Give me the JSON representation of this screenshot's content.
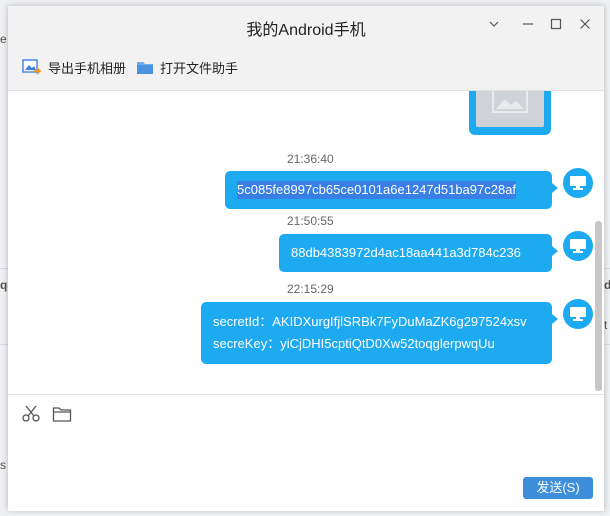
{
  "window": {
    "title": "我的Android手机"
  },
  "toolbar": {
    "export_album": "导出手机相册",
    "open_file_helper": "打开文件助手"
  },
  "messages": [
    {
      "time": "21:36:40",
      "lines": [
        "5c085fe8997cb65ce0101a6e1247d51ba97c28af"
      ]
    },
    {
      "time": "21:50:55",
      "lines": [
        "88db4383972d4ac18aa441a3d784c236"
      ]
    },
    {
      "time": "22:15:29",
      "lines": [
        "secretId：AKIDXurgIfjlSRBk7FyDuMaZK6g297524xsv",
        "secreKey：yiCjDHI5cptiQtD0Xw52toqglerpwqUu"
      ]
    }
  ],
  "input": {
    "send_label": "发送(S)"
  },
  "colors": {
    "bubble": "#1eaaf1",
    "send_button": "#3d8fdc",
    "selection": "#3a7fe6"
  },
  "icons": [
    "image-export-icon",
    "folder-icon",
    "monitor-icon",
    "scissors-icon",
    "file-folder-icon",
    "minimize-icon",
    "maximize-icon",
    "close-icon",
    "chevron-down-icon"
  ]
}
